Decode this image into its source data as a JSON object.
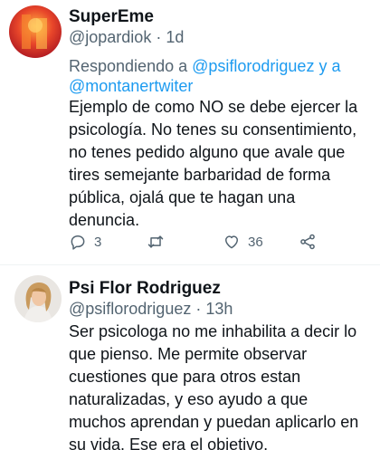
{
  "tweets": [
    {
      "display_name": "SuperEme",
      "handle": "@jopardiok",
      "separator": " · ",
      "time": "1d",
      "replying_prefix": "Respondiendo a ",
      "replying_to_1": "@psiflorodriguez",
      "replying_joiner": " y a",
      "replying_to_2": "@montanertwiter",
      "text": "Ejemplo de como NO se debe ejercer la\npsicología. No tenes su consentimiento,\nno tenes pedido alguno que avale que\ntires semejante barbaridad de forma\npública, ojalá que te hagan una\ndenuncia.",
      "reply_count": "3",
      "retweet_count": "",
      "like_count": "36"
    },
    {
      "display_name": "Psi Flor Rodriguez",
      "handle": "@psiflorodriguez",
      "separator": " · ",
      "time": "13h",
      "text": "Ser psicologa no me inhabilita a decir lo\nque pienso. Me permite observar\ncuestiones que para otros estan\nnaturalizadas, y eso ayudo a que\nmuchos aprendan y puedan aplicarlo en\nsu vida. Ese era el objetivo."
    }
  ],
  "icons": {
    "reply": "reply-icon",
    "retweet": "retweet-icon",
    "like": "heart-icon",
    "share": "share-icon"
  },
  "colors": {
    "text": "#0f1419",
    "secondary": "#536471",
    "link": "#1d9bf0",
    "divider": "#eff3f4"
  }
}
